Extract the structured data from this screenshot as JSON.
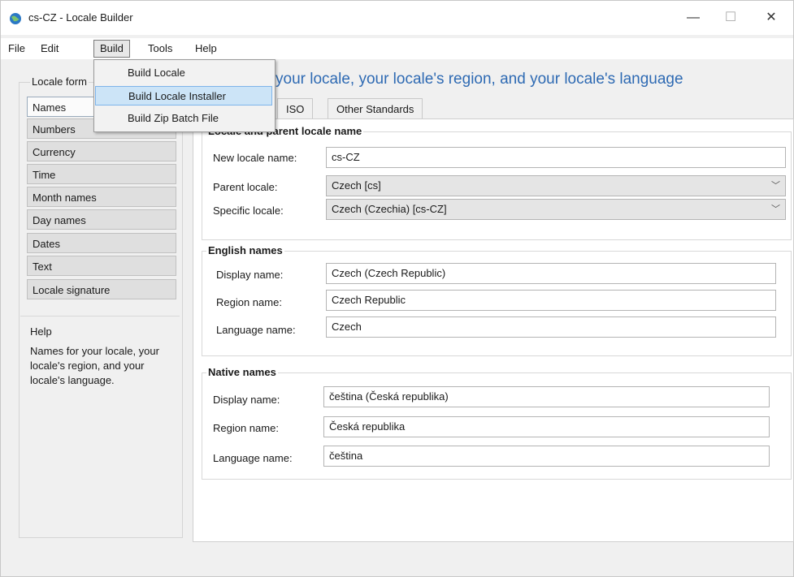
{
  "window": {
    "title": "cs-CZ - Locale Builder",
    "controls": {
      "minimize": "—",
      "maximize": "☐",
      "close": "✕"
    }
  },
  "menubar": {
    "items": [
      "File",
      "Edit",
      "Build",
      "Tools",
      "Help"
    ],
    "open_menu": "Build",
    "dropdown": [
      {
        "label": "Build Locale",
        "highlighted": false
      },
      {
        "label": "Build Locale Installer",
        "highlighted": true
      },
      {
        "label": "Build Zip Batch File",
        "highlighted": false
      }
    ]
  },
  "header": {
    "text": "your locale, your locale's region, and your locale's language"
  },
  "left_panel": {
    "group_label": "Locale form",
    "nav": [
      "Names",
      "Numbers",
      "Currency",
      "Time",
      "Month names",
      "Day names",
      "Dates",
      "Text",
      "Locale signature"
    ],
    "active": "Names",
    "help_title": "Help",
    "help_body": "Names for your locale, your locale's region, and your locale's language."
  },
  "tabs": [
    "ISO",
    "Other Standards"
  ],
  "sections": {
    "locale": {
      "legend": "Locale and parent locale name",
      "new_locale_label": "New locale name:",
      "new_locale_value": "cs-CZ",
      "parent_label": "Parent locale:",
      "parent_value": "Czech [cs]",
      "specific_label": "Specific locale:",
      "specific_value": "Czech (Czechia) [cs-CZ]"
    },
    "english": {
      "legend": "English names",
      "display_label": "Display name:",
      "display_value": "Czech (Czech Republic)",
      "region_label": "Region name:",
      "region_value": "Czech Republic",
      "language_label": "Language name:",
      "language_value": "Czech"
    },
    "native": {
      "legend": "Native names",
      "display_label": "Display name:",
      "display_value": "čeština (Česká republika)",
      "region_label": "Region name:",
      "region_value": "Česká republika",
      "language_label": "Language name:",
      "language_value": "čeština"
    }
  },
  "icons": {
    "app": "globe-icon",
    "dropdown_arrow": "chevron-down-icon"
  },
  "colors": {
    "header": "#2e6ab3",
    "highlight": "#cce4f7"
  }
}
